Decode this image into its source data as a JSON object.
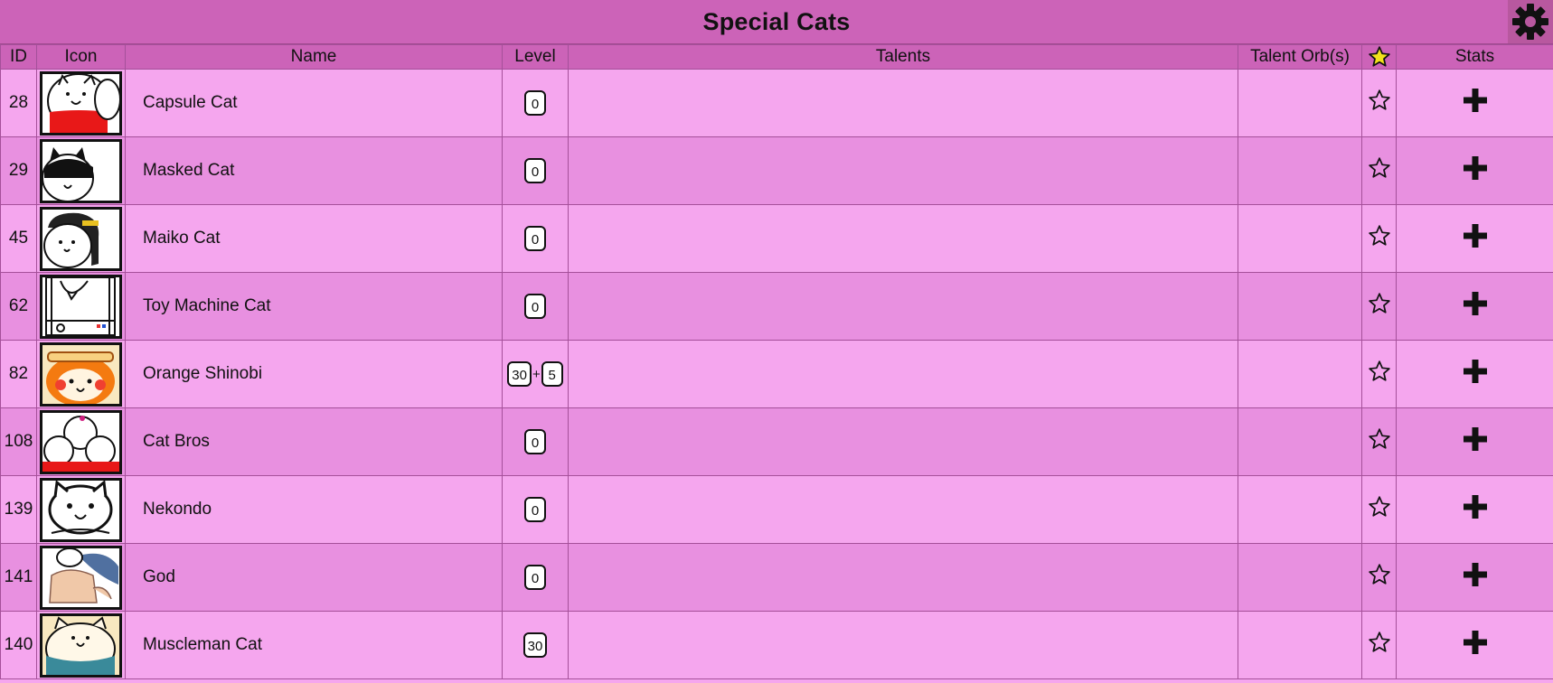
{
  "page": {
    "title": "Special Cats",
    "settings_icon": "gear-icon"
  },
  "columns": {
    "id": "ID",
    "icon": "Icon",
    "name": "Name",
    "level": "Level",
    "talents": "Talents",
    "talent_orbs": "Talent Orb(s)",
    "favorite_icon": "star-filled-icon",
    "stats": "Stats"
  },
  "rows": [
    {
      "id": "28",
      "name": "Capsule Cat",
      "level": "0",
      "plus_level": null,
      "icon": "capsule-cat-icon"
    },
    {
      "id": "29",
      "name": "Masked Cat",
      "level": "0",
      "plus_level": null,
      "icon": "masked-cat-icon"
    },
    {
      "id": "45",
      "name": "Maiko Cat",
      "level": "0",
      "plus_level": null,
      "icon": "maiko-cat-icon"
    },
    {
      "id": "62",
      "name": "Toy Machine Cat",
      "level": "0",
      "plus_level": null,
      "icon": "toy-machine-cat-icon"
    },
    {
      "id": "82",
      "name": "Orange Shinobi",
      "level": "30",
      "plus_level": "5",
      "icon": "orange-shinobi-icon"
    },
    {
      "id": "108",
      "name": "Cat Bros",
      "level": "0",
      "plus_level": null,
      "icon": "cat-bros-icon"
    },
    {
      "id": "139",
      "name": "Nekondo",
      "level": "0",
      "plus_level": null,
      "icon": "nekondo-icon"
    },
    {
      "id": "141",
      "name": "God",
      "level": "0",
      "plus_level": null,
      "icon": "god-icon"
    },
    {
      "id": "140",
      "name": "Muscleman Cat",
      "level": "30",
      "plus_level": null,
      "icon": "muscleman-cat-icon"
    }
  ],
  "colors": {
    "header_bg": "#cc63b8",
    "row_light": "#f5a6ee",
    "row_dark": "#e890e0",
    "favorite_star": "#f2e21c"
  },
  "row_icons": {
    "favorite": "star-outline-icon",
    "stats": "plus-icon"
  },
  "plus_separator": "+"
}
